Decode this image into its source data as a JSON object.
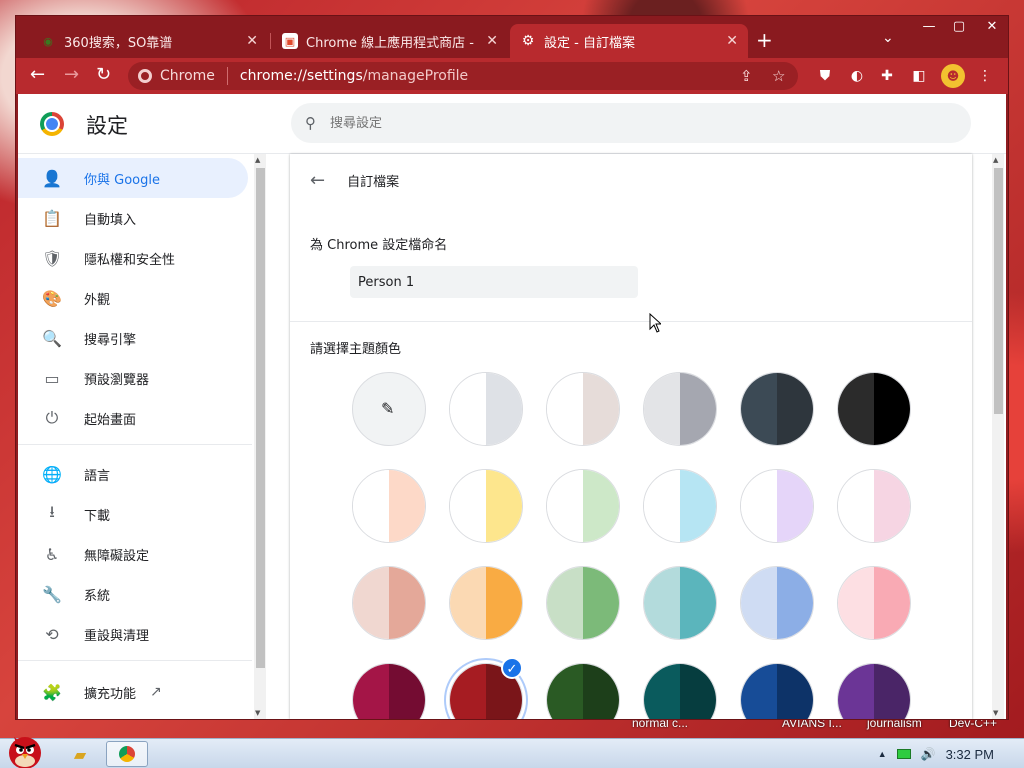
{
  "window": {
    "tabs": [
      {
        "title": "360搜索，SO靠谱",
        "favicon": "360-search-icon"
      },
      {
        "title": "Chrome 線上應用程式商店 - chi",
        "favicon": "web-store-icon"
      },
      {
        "title": "設定 - 自訂檔案",
        "favicon": "gear-icon"
      }
    ],
    "new_tab": "+",
    "tab_search": "⌄",
    "controls": {
      "minimize": "—",
      "maximize": "▢",
      "close": "✕"
    }
  },
  "toolbar": {
    "back": "←",
    "forward": "→",
    "reload": "↻",
    "site_label": "Chrome",
    "url_host": "chrome://settings",
    "url_path": "/manageProfile"
  },
  "settings": {
    "title": "設定",
    "search_placeholder": "搜尋設定"
  },
  "sidebar": {
    "items": [
      {
        "label": "你與 Google",
        "icon": "person-icon",
        "glyph": "👤",
        "selected": true
      },
      {
        "label": "自動填入",
        "icon": "clipboard-icon",
        "glyph": "📋"
      },
      {
        "label": "隱私權和安全性",
        "icon": "shield-icon",
        "glyph": "🛡"
      },
      {
        "label": "外觀",
        "icon": "palette-icon",
        "glyph": "🎨"
      },
      {
        "label": "搜尋引擎",
        "icon": "search-icon",
        "glyph": "🔍"
      },
      {
        "label": "預設瀏覽器",
        "icon": "browser-icon",
        "glyph": "▭"
      },
      {
        "label": "起始畫面",
        "icon": "power-icon",
        "glyph": "⏻"
      },
      {
        "label": "語言",
        "icon": "globe-icon",
        "glyph": "🌐"
      },
      {
        "label": "下載",
        "icon": "download-icon",
        "glyph": "⭳"
      },
      {
        "label": "無障礙設定",
        "icon": "accessibility-icon",
        "glyph": "♿"
      },
      {
        "label": "系統",
        "icon": "wrench-icon",
        "glyph": "🔧"
      },
      {
        "label": "重設與清理",
        "icon": "history-icon",
        "glyph": "⟲"
      },
      {
        "label": "擴充功能",
        "icon": "puzzle-icon",
        "glyph": "🧩",
        "external": "↗"
      }
    ]
  },
  "profile": {
    "header": "自訂檔案",
    "name_label": "為 Chrome 設定檔命名",
    "name_value": "Person 1",
    "theme_label": "請選擇主題顏色",
    "swatches": [
      [
        "#f1f3f4",
        "#f1f3f4"
      ],
      [
        "#ffffff",
        "#dee1e6"
      ],
      [
        "#ffffff",
        "#e6dcd9"
      ],
      [
        "#e3e4e7",
        "#a5a7b0"
      ],
      [
        "#3c4a55",
        "#2e363d"
      ],
      [
        "#2b2b2b",
        "#000000"
      ],
      [
        "#ffffff",
        "#fdd9c8"
      ],
      [
        "#ffffff",
        "#fde68d"
      ],
      [
        "#ffffff",
        "#cde8c8"
      ],
      [
        "#ffffff",
        "#b6e5f3"
      ],
      [
        "#ffffff",
        "#e5d5f9"
      ],
      [
        "#ffffff",
        "#f6d5e3"
      ],
      [
        "#f0d7d0",
        "#e4a899"
      ],
      [
        "#fbd9b3",
        "#f9ab43"
      ],
      [
        "#c8dfc6",
        "#7cba79"
      ],
      [
        "#b3dbdc",
        "#5bb5bc"
      ],
      [
        "#cfdcf3",
        "#8caee6"
      ],
      [
        "#fddfe3",
        "#f9aab4"
      ],
      [
        "#a41547",
        "#740c32"
      ],
      [
        "#a61c22",
        "#7a1519"
      ],
      [
        "#2a5a24",
        "#1d3f1a"
      ],
      [
        "#0a5b5d",
        "#063d3f"
      ],
      [
        "#174c97",
        "#0d3368"
      ],
      [
        "#6b3596",
        "#4a2567"
      ]
    ],
    "selected_swatch": 19,
    "check": "✓",
    "picker": "✎"
  },
  "taskbar": {
    "clock": "3:32 PM",
    "background_labels": [
      "normal c...",
      "AVIANS I...",
      "journalism",
      "Dev-C++"
    ]
  }
}
